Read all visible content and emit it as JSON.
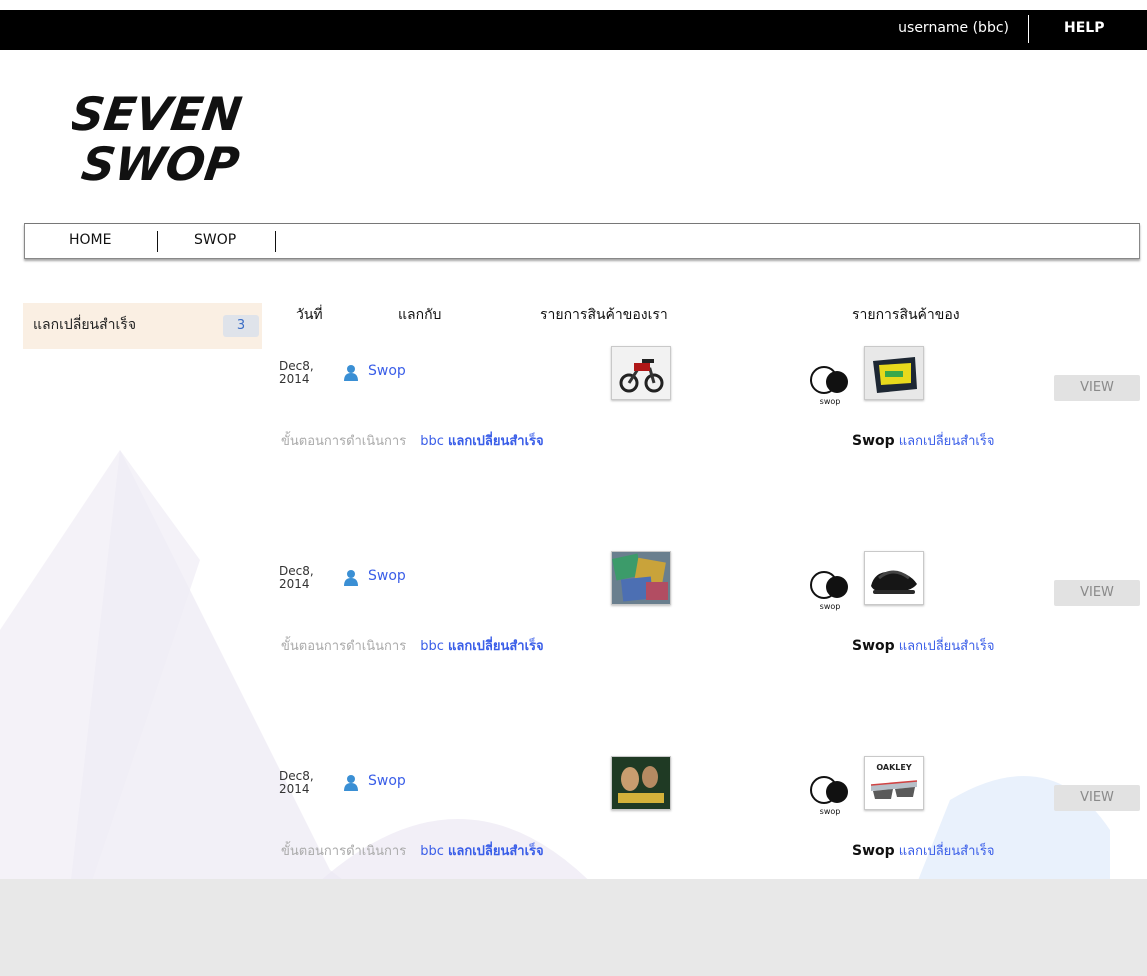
{
  "header": {
    "username": "username (bbc)",
    "help": "HELP"
  },
  "logo": {
    "text_line1": "SEVEN",
    "text_line2": "SWOP"
  },
  "nav": {
    "items": [
      {
        "label": "HOME"
      },
      {
        "label": "SWOP"
      }
    ]
  },
  "sidebar": {
    "label": "แลกเปลี่ยนสำเร็จ",
    "count": "3"
  },
  "table": {
    "columns": [
      "วันที่",
      "แลกกับ",
      "รายการสินค้าของเรา",
      "รายการสินค้าของ"
    ],
    "rows": [
      {
        "date_line1": "Dec8,",
        "date_line2": "2014",
        "partner": "Swop",
        "steps_label": "ขั้นตอนการดำเนินการ",
        "our_name": "bbc",
        "our_status": "แลกเปลี่ยนสำเร็จ",
        "their_name": "Swop",
        "their_status": "แลกเปลี่ยนสำเร็จ",
        "our_item": "motorcycle",
        "their_item": "yellow-bag",
        "view_label": "VIEW"
      },
      {
        "date_line1": "Dec8,",
        "date_line2": "2014",
        "partner": "Swop",
        "steps_label": "ขั้นตอนการดำเนินการ",
        "our_name": "bbc",
        "our_status": "แลกเปลี่ยนสำเร็จ",
        "their_name": "Swop",
        "their_status": "แลกเปลี่ยนสำเร็จ",
        "our_item": "comic-collage",
        "their_item": "sandals",
        "view_label": "VIEW"
      },
      {
        "date_line1": "Dec8,",
        "date_line2": "2014",
        "partner": "Swop",
        "steps_label": "ขั้นตอนการดำเนินการ",
        "our_name": "bbc",
        "our_status": "แลกเปลี่ยนสำเร็จ",
        "their_name": "Swop",
        "their_status": "แลกเปลี่ยนสำเร็จ",
        "our_item": "movie-poster",
        "their_item": "oakley-glasses",
        "view_label": "VIEW"
      }
    ],
    "badge_text": "swop",
    "brand_text": "OAKLEY"
  }
}
